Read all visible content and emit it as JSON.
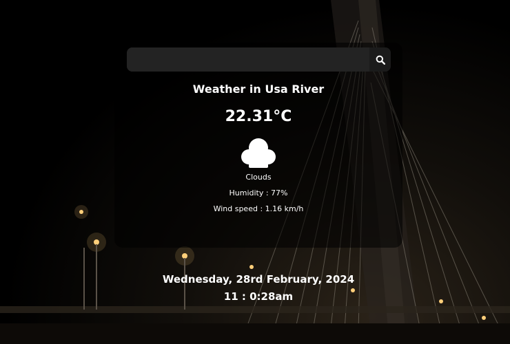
{
  "search": {
    "placeholder": "",
    "value": "",
    "icon": "search-icon"
  },
  "weather": {
    "title": "Weather in Usa River",
    "temperature": "22.31°C",
    "icon": "cloud-icon",
    "condition": "Clouds",
    "humidity": "Humidity : 77%",
    "wind": "Wind speed : 1.16 km/h"
  },
  "datetime": {
    "date": "Wednesday, 28rd February, 2024",
    "time": "11 : 0:28am"
  },
  "colors": {
    "text": "#ffffff",
    "card": "#000000"
  }
}
